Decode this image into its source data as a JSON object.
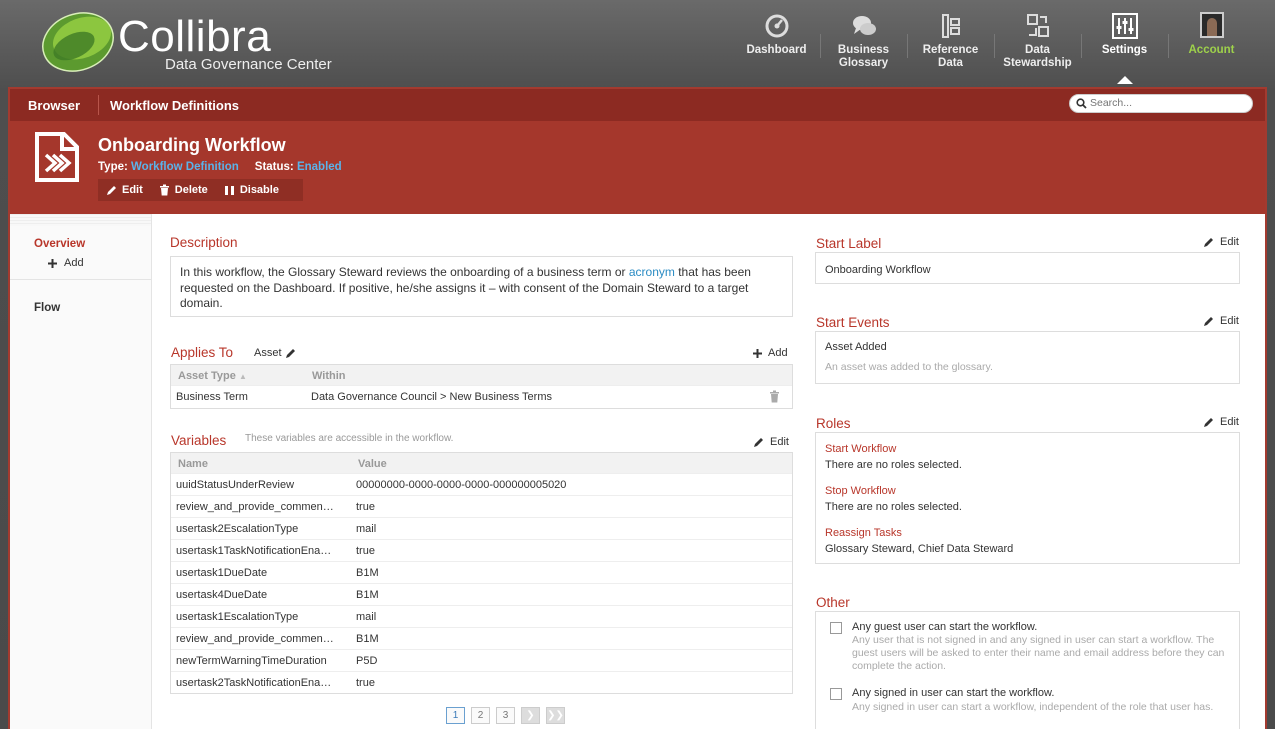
{
  "header": {
    "brand": "Collibra",
    "tagline": "Data Governance Center",
    "nav": [
      {
        "label_1": "Dashboard",
        "label_2": "",
        "icon": "dashboard-icon"
      },
      {
        "label_1": "Business",
        "label_2": "Glossary",
        "icon": "chat-bubbles-icon"
      },
      {
        "label_1": "Reference",
        "label_2": "Data",
        "icon": "reference-data-icon"
      },
      {
        "label_1": "Data",
        "label_2": "Stewardship",
        "icon": "stewardship-icon"
      },
      {
        "label_1": "Settings",
        "label_2": "",
        "icon": "sliders-icon",
        "active": true
      },
      {
        "label_1": "Account",
        "label_2": "",
        "icon": "avatar"
      }
    ]
  },
  "crumbs": {
    "browser": "Browser",
    "current": "Workflow Definitions",
    "search_placeholder": "Search..."
  },
  "asset": {
    "title": "Onboarding Workflow",
    "type_label": "Type:",
    "type_value": "Workflow Definition",
    "status_label": "Status:",
    "status_value": "Enabled",
    "actions": {
      "edit": "Edit",
      "delete": "Delete",
      "disable": "Disable"
    }
  },
  "sidebar": {
    "overview": "Overview",
    "add": "Add",
    "flow": "Flow"
  },
  "description": {
    "title": "Description",
    "text_before": "In this workflow, the Glossary Steward reviews the onboarding of a business term or ",
    "link": "acronym",
    "text_after": " that has been requested on the Dashboard. If positive, he/she assigns it – with consent of the Domain Steward to a target domain."
  },
  "applies_to": {
    "title": "Applies To",
    "scope": "Asset",
    "add": "Add",
    "col_type": "Asset Type",
    "col_within": "Within",
    "rows": [
      {
        "type": "Business Term",
        "within": "Data Governance Council > New Business Terms"
      }
    ]
  },
  "variables": {
    "title": "Variables",
    "hint": "These variables are accessible in the workflow.",
    "edit": "Edit",
    "col_name": "Name",
    "col_value": "Value",
    "rows": [
      {
        "name": "uuidStatusUnderReview",
        "value": "00000000-0000-0000-0000-000000005020"
      },
      {
        "name": "review_and_provide_commen…",
        "value": "true"
      },
      {
        "name": "usertask2EscalationType",
        "value": "mail"
      },
      {
        "name": "usertask1TaskNotificationEna…",
        "value": "true"
      },
      {
        "name": "usertask1DueDate",
        "value": "B1M"
      },
      {
        "name": "usertask4DueDate",
        "value": "B1M"
      },
      {
        "name": "usertask1EscalationType",
        "value": "mail"
      },
      {
        "name": "review_and_provide_commen…",
        "value": "B1M"
      },
      {
        "name": "newTermWarningTimeDuration",
        "value": "P5D"
      },
      {
        "name": "usertask2TaskNotificationEna…",
        "value": "true"
      }
    ],
    "pages": [
      "1",
      "2",
      "3"
    ]
  },
  "start_label": {
    "title": "Start Label",
    "edit": "Edit",
    "value": "Onboarding Workflow"
  },
  "start_events": {
    "title": "Start Events",
    "edit": "Edit",
    "event": "Asset Added",
    "desc": "An asset was added to the glossary."
  },
  "roles": {
    "title": "Roles",
    "edit": "Edit",
    "start_label": "Start Workflow",
    "start_value": "There are no roles selected.",
    "stop_label": "Stop Workflow",
    "stop_value": "There are no roles selected.",
    "reassign_label": "Reassign Tasks",
    "reassign_value": "Glossary Steward, Chief Data Steward"
  },
  "other": {
    "title": "Other",
    "opt1_label": "Any guest user can start the workflow.",
    "opt1_desc": "Any user that is not signed in and any signed in user can start a workflow. The guest users will be asked to enter their name and email address before they can complete the action.",
    "opt2_label": "Any signed in user can start the workflow.",
    "opt2_desc": "Any signed in user can start a workflow, independent of the role that user has."
  },
  "colors": {
    "accent": "#a5372c",
    "link": "#2b8cc4",
    "section_title": "#b8362a",
    "account": "#9ed14b"
  }
}
